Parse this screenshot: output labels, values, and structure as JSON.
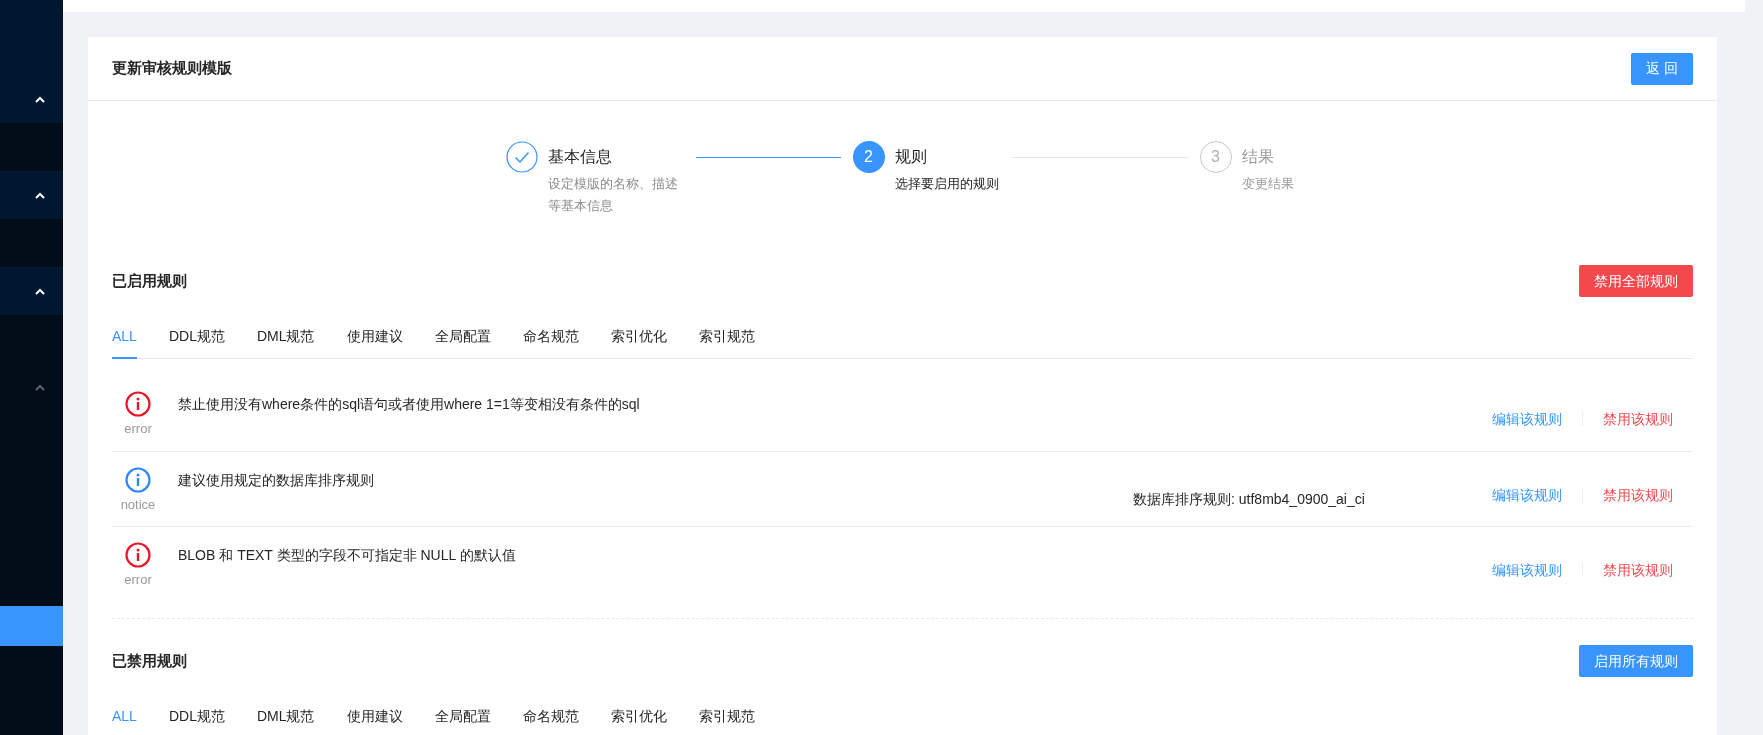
{
  "sidebar": {
    "items": [
      {
        "kind": "group",
        "expanded": true,
        "disabled": false,
        "selected": false
      },
      {
        "kind": "group",
        "expanded": true,
        "disabled": false,
        "selected": false
      },
      {
        "kind": "group",
        "expanded": true,
        "disabled": false,
        "selected": false
      },
      {
        "kind": "group",
        "expanded": true,
        "disabled": true,
        "selected": false
      },
      {
        "kind": "item",
        "selected": true
      }
    ]
  },
  "page": {
    "title": "更新审核规则模版",
    "back_button": "返 回"
  },
  "steps": [
    {
      "done": true,
      "current": false,
      "title": "基本信息",
      "description": "设定模版的名称、描述等基本信息"
    },
    {
      "done": false,
      "current": true,
      "number": "2",
      "title": "规则",
      "description": "选择要启用的规则"
    },
    {
      "done": false,
      "current": false,
      "number": "3",
      "title": "结果",
      "description": "变更结果"
    }
  ],
  "sections": [
    {
      "kind": "enabled",
      "title": "已启用规则",
      "button": "禁用全部规则",
      "tabs": [
        {
          "label": "ALL",
          "selected": true
        },
        {
          "label": "DDL规范",
          "selected": false
        },
        {
          "label": "DML规范",
          "selected": false
        },
        {
          "label": "使用建议",
          "selected": false
        },
        {
          "label": "全局配置",
          "selected": false
        },
        {
          "label": "命名规范",
          "selected": false
        },
        {
          "label": "索引优化",
          "selected": false
        },
        {
          "label": "索引规范",
          "selected": false
        }
      ],
      "rules": [
        {
          "kind": "error",
          "level_label": "error",
          "description": "禁止使用没有where条件的sql语句或者使用where 1=1等变相没有条件的sql",
          "edit": "编辑该规则",
          "disable": "禁用该规则"
        },
        {
          "kind": "notice",
          "level_label": "notice",
          "description": "建议使用规定的数据库排序规则",
          "value": "数据库排序规则: utf8mb4_0900_ai_ci",
          "edit": "编辑该规则",
          "disable": "禁用该规则"
        },
        {
          "kind": "error",
          "level_label": "error",
          "description": "BLOB 和 TEXT 类型的字段不可指定非 NULL 的默认值",
          "edit": "编辑该规则",
          "disable": "禁用该规则"
        }
      ]
    },
    {
      "kind": "disabled",
      "title": "已禁用规则",
      "button": "启用所有规则",
      "tabs": [
        {
          "label": "ALL",
          "selected": true
        },
        {
          "label": "DDL规范",
          "selected": false
        },
        {
          "label": "DML规范",
          "selected": false
        },
        {
          "label": "使用建议",
          "selected": false
        },
        {
          "label": "全局配置",
          "selected": false
        },
        {
          "label": "命名规范",
          "selected": false
        },
        {
          "label": "索引优化",
          "selected": false
        },
        {
          "label": "索引规范",
          "selected": false
        }
      ]
    }
  ]
}
